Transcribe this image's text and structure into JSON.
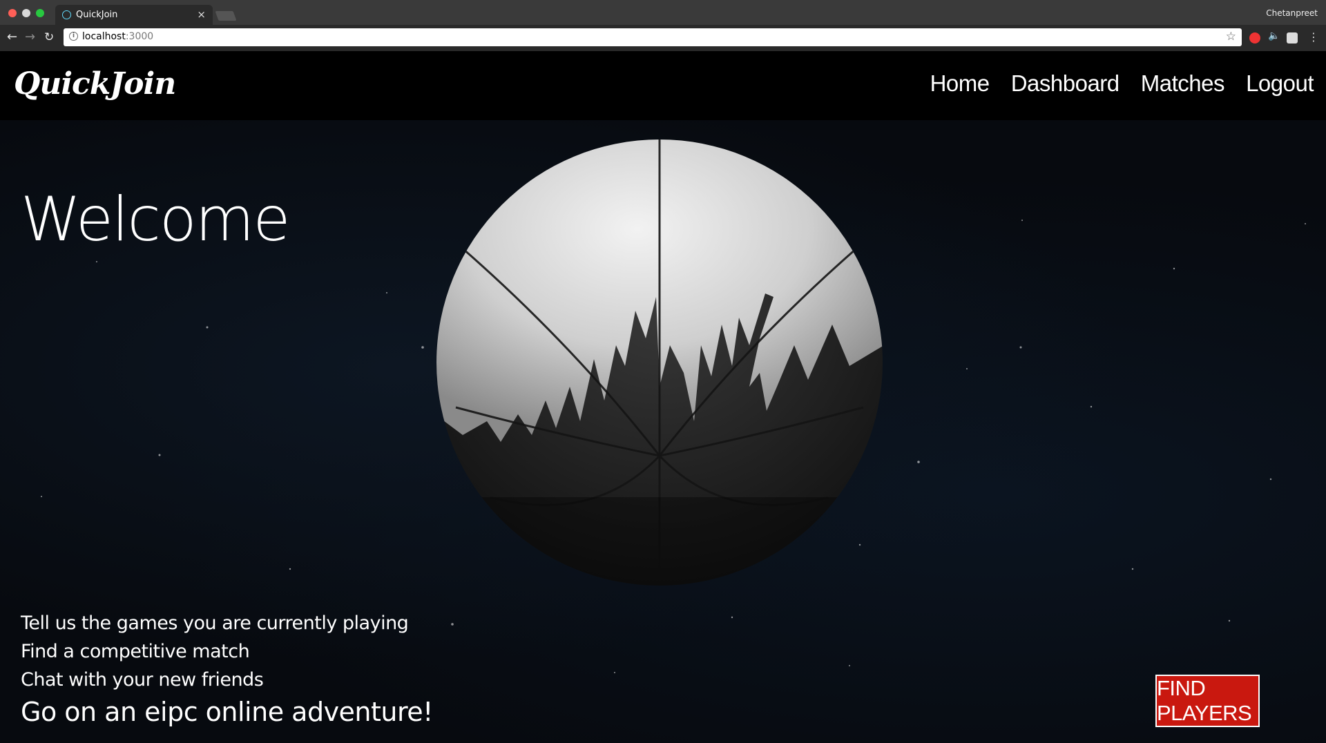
{
  "browser": {
    "tab_title": "QuickJoin",
    "tab_close": "×",
    "profile": "Chetanpreet",
    "url_host": "localhost",
    "url_port": ":3000",
    "star_icon": "☆",
    "back_icon": "←",
    "forward_icon": "→",
    "reload_icon": "↻",
    "info_icon": "i",
    "mute_icon": "🔈",
    "menu_icon": "⋮"
  },
  "app": {
    "logo": "QuickJoin",
    "nav": [
      "Home",
      "Dashboard",
      "Matches",
      "Logout"
    ],
    "hero": {
      "heading": "Welcome",
      "features": [
        "Tell us the games you are currently playing",
        "Find a competitive match",
        "Chat with your new friends"
      ],
      "tagline": "Go on an eipc online adventure!",
      "cta": "FIND PLAYERS"
    }
  },
  "colors": {
    "cta_bg": "#c9180f",
    "navbar_bg": "#000000",
    "hero_bg": "#070a0f"
  }
}
